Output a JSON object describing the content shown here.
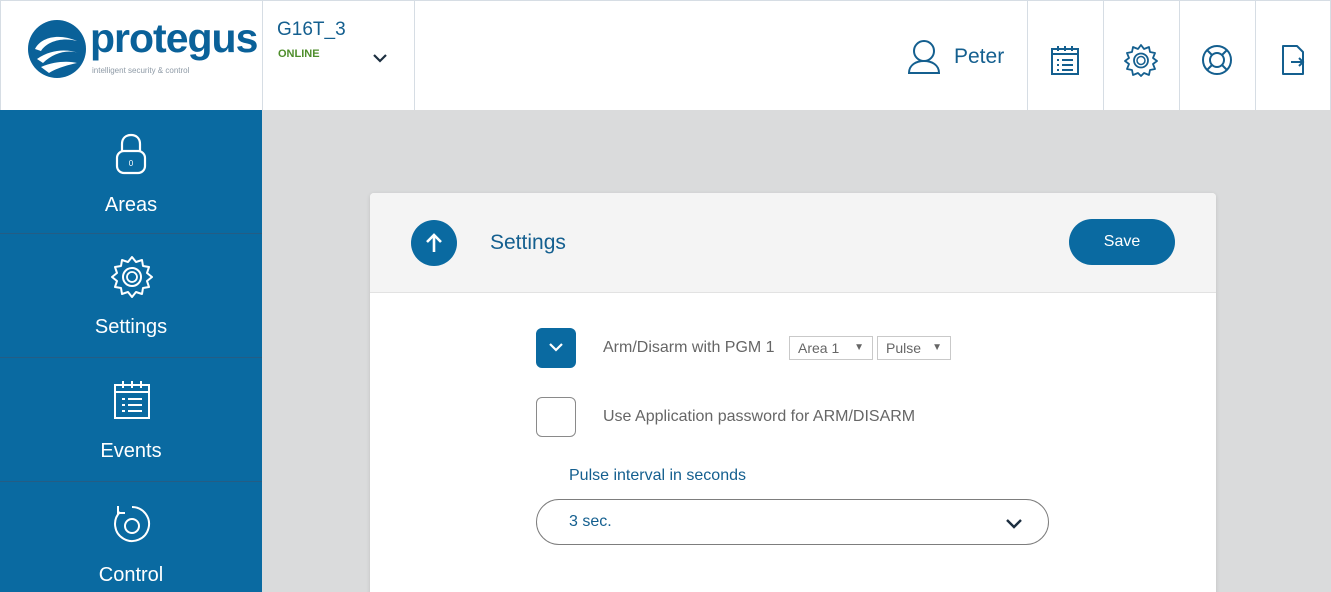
{
  "brand": {
    "name": "protegus",
    "tagline": "intelligent security & control",
    "primary_color": "#0a6aa1",
    "text_color": "#145f8f"
  },
  "device": {
    "name": "G16T_3",
    "status": "ONLINE",
    "status_color": "#4f8e2c"
  },
  "user": {
    "name": "Peter"
  },
  "header_icons": [
    "events-calendar-icon",
    "gear-icon",
    "lifebuoy-icon",
    "logout-icon"
  ],
  "sidebar": {
    "items": [
      {
        "label": "Areas",
        "icon": "padlock-icon"
      },
      {
        "label": "Settings",
        "icon": "gear-icon"
      },
      {
        "label": "Events",
        "icon": "calendar-list-icon"
      },
      {
        "label": "Control",
        "icon": "rotate-icon"
      }
    ]
  },
  "card": {
    "title": "Settings",
    "save_label": "Save",
    "options": [
      {
        "label": "Arm/Disarm with PGM 1",
        "checked": true
      },
      {
        "label": "Use Application password for ARM/DISARM",
        "checked": false
      }
    ],
    "area_select": "Area 1",
    "mode_select": "Pulse",
    "pulse_label": "Pulse interval in seconds",
    "pulse_value": "3 sec."
  }
}
